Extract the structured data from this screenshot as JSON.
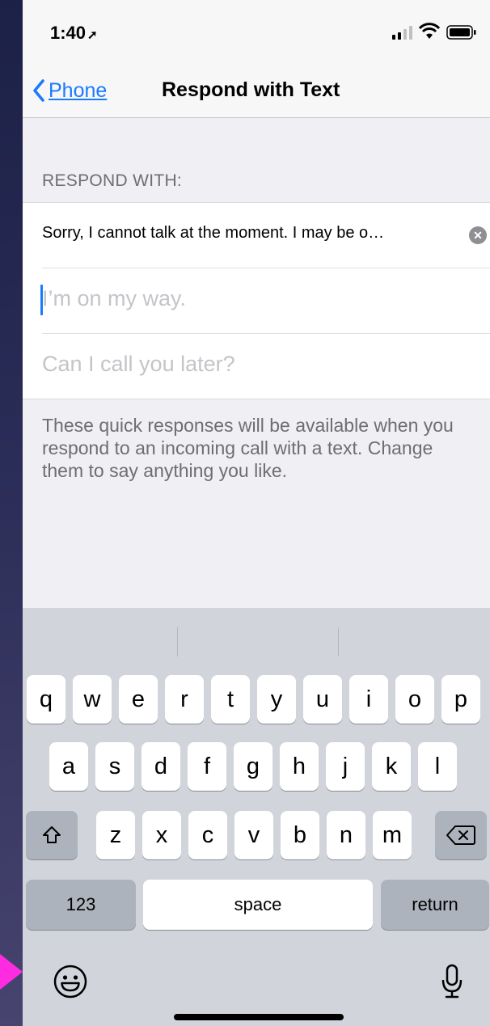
{
  "status": {
    "time": "1:40",
    "location_icon": "location-arrow-icon"
  },
  "nav": {
    "back_label": "Phone",
    "title": "Respond with Text"
  },
  "section_header": "RESPOND WITH:",
  "responses": [
    {
      "text": "Sorry, I cannot talk at the moment. I may be o…",
      "is_value": true
    },
    {
      "placeholder": "I’m on my way.",
      "is_value": false
    },
    {
      "placeholder": "Can I call you later?",
      "is_value": false
    }
  ],
  "footer_text": "These quick responses will be available when you respond to an incoming call with a text. Change them to say anything you like.",
  "keyboard": {
    "row1": [
      "q",
      "w",
      "e",
      "r",
      "t",
      "y",
      "u",
      "i",
      "o",
      "p"
    ],
    "row2": [
      "a",
      "s",
      "d",
      "f",
      "g",
      "h",
      "j",
      "k",
      "l"
    ],
    "row3": [
      "z",
      "x",
      "c",
      "v",
      "b",
      "n",
      "m"
    ],
    "numbers_label": "123",
    "space_label": "space",
    "return_label": "return"
  },
  "colors": {
    "accent": "#1a7aff",
    "marker": "#ff2be0"
  }
}
